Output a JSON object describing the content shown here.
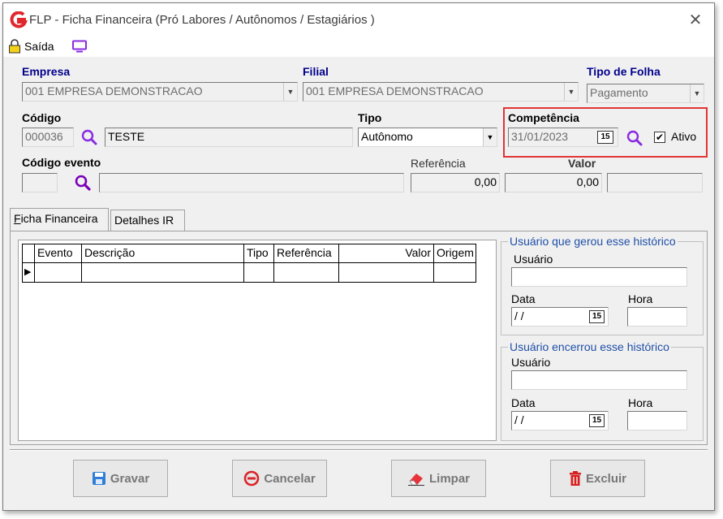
{
  "window": {
    "title": "FLP - Ficha Financeira (Pró Labores / Autônomos / Estagiários )",
    "close_glyph": "✕"
  },
  "toolbar": {
    "exit_label": "Saída",
    "exit_icon": "lock-icon",
    "screen_icon": "monitor-icon"
  },
  "empresa": {
    "label": "Empresa",
    "value": "001 EMPRESA DEMONSTRACAO"
  },
  "filial": {
    "label": "Filial",
    "value": "001 EMPRESA DEMONSTRACAO"
  },
  "tipo_folha": {
    "label": "Tipo de Folha",
    "value": "Pagamento"
  },
  "codigo": {
    "label": "Código",
    "value": "000036",
    "name_value": "TESTE"
  },
  "tipo": {
    "label": "Tipo",
    "value": "Autônomo"
  },
  "competencia": {
    "label": "Competência",
    "value": "31/01/2023",
    "calendar_text": "15"
  },
  "ativo": {
    "label": "Ativo",
    "checked": "✔"
  },
  "codigo_evento": {
    "label": "Código evento",
    "value": "",
    "description": ""
  },
  "referencia": {
    "label": "Referência",
    "value": "0,00"
  },
  "valor": {
    "label": "Valor",
    "value": "0,00",
    "extra": ""
  },
  "tabs": [
    {
      "label_underlined": "F",
      "label_rest": "icha Financeira"
    },
    {
      "label_underlined": "",
      "label_rest": "Detalhes IR"
    }
  ],
  "grid": {
    "columns": [
      "Evento",
      "Descrição",
      "Tipo",
      "Referência",
      "Valor",
      "Origem"
    ],
    "row_indicator": "▶"
  },
  "group_gerou": {
    "title": "Usuário que gerou esse histórico",
    "user_label": "Usuário",
    "date_label": "Data",
    "date_value": "/ /",
    "calendar_text": "15",
    "hour_label": "Hora"
  },
  "group_encerrou": {
    "title": "Usuário encerrou esse histórico",
    "user_label": "Usuário",
    "date_label": "Data",
    "date_value": "/ /",
    "calendar_text": "15",
    "hour_label": "Hora"
  },
  "buttons": {
    "save": "Gravar",
    "cancel": "Cancelar",
    "clear": "Limpar",
    "delete": "Excluir"
  },
  "colors": {
    "accent_blue": "#00008b",
    "highlight_red": "#e23434",
    "search_purple": "#8a2be2",
    "save_blue": "#2f7fd6",
    "cancel_red": "#d9252a",
    "clear_red": "#e8333a",
    "delete_red": "#d62020"
  }
}
